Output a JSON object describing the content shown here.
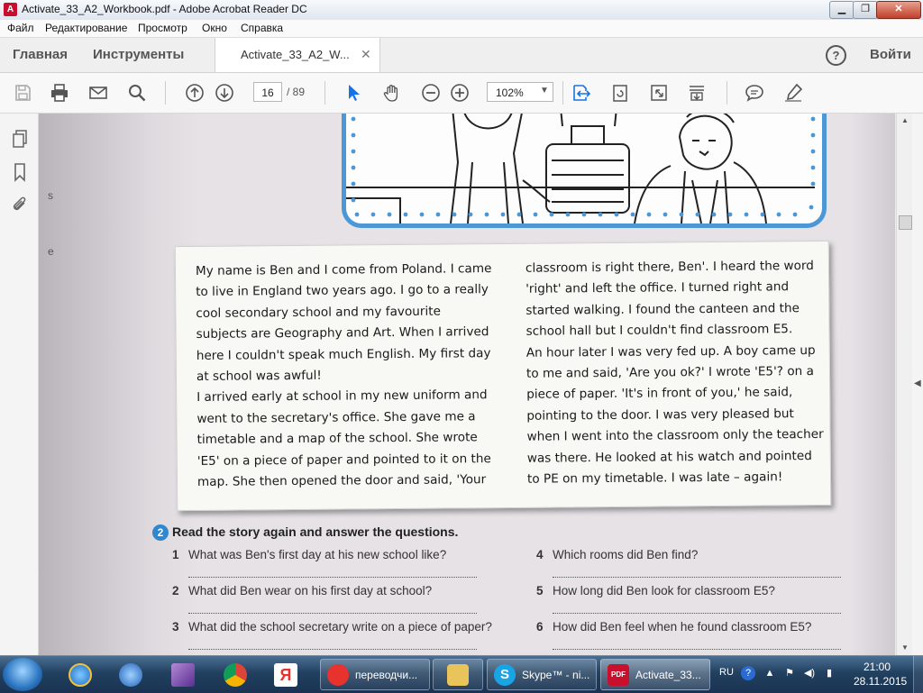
{
  "window": {
    "title": "Activate_33_A2_Workbook.pdf - Adobe Acrobat Reader DC",
    "app_icon": "acrobat-icon"
  },
  "menu": [
    "Файл",
    "Редактирование",
    "Просмотр",
    "Окно",
    "Справка"
  ],
  "tabs": {
    "home": "Главная",
    "tools": "Инструменты",
    "document": "Activate_33_A2_W...",
    "sign_in": "Войти"
  },
  "toolbar": {
    "page_current": "16",
    "page_total": "/ 89",
    "zoom": "102%"
  },
  "margin_text": [
    "s",
    "e"
  ],
  "story": {
    "left": [
      "My name is Ben and I come from Poland. I came",
      "to live in England two years ago. I go to a really",
      "cool secondary school and my favourite",
      "subjects are Geography and Art. When I arrived",
      "here I couldn't speak much English. My first day",
      "at school was awful!",
      "I arrived early at school in my new uniform and",
      "went to the secretary's office. She gave me a",
      "timetable and a map of the school. She wrote",
      "'E5' on a piece of paper and pointed to it on the",
      "map. She then opened the door and said, 'Your"
    ],
    "right": [
      "classroom is right there, Ben'. I heard the word",
      "'right' and left the office. I turned right and",
      "started walking. I found the canteen and the",
      "school hall but I couldn't find classroom E5.",
      "An hour later I was very fed up. A boy came up",
      "to me and said, 'Are you ok?' I wrote 'E5'? on a",
      "piece of paper. 'It's in front of you,' he said,",
      "pointing to the door. I was very pleased but",
      "when I went into the classroom only the teacher",
      "was there. He looked at his watch and pointed",
      "to PE on my timetable. I was late – again!"
    ]
  },
  "exercise": {
    "number": "2",
    "title": "Read the story again and answer the questions.",
    "questions": [
      {
        "n": "1",
        "text": "What was Ben's first day at his new school like?"
      },
      {
        "n": "2",
        "text": "What did Ben wear on his first day at school?"
      },
      {
        "n": "3",
        "text": "What did the school secretary write on a piece of paper?"
      },
      {
        "n": "4",
        "text": "Which rooms did Ben find?"
      },
      {
        "n": "5",
        "text": "How long did Ben look for classroom E5?"
      },
      {
        "n": "6",
        "text": "How did Ben feel when he found classroom E5?"
      }
    ]
  },
  "taskbar": {
    "tasks": [
      {
        "label": "переводчи...",
        "icon": "yandex-icon",
        "color": "#e8322e"
      },
      {
        "label": "",
        "icon": "explorer-folder-icon",
        "color": "#e9c45a"
      },
      {
        "label": "Skype™ - ni...",
        "icon": "skype-icon",
        "color": "#19a4e6"
      },
      {
        "label": "Activate_33...",
        "icon": "acrobat-pdf-icon",
        "color": "#c8102e"
      }
    ],
    "language": "RU",
    "time": "21:00",
    "date": "28.11.2015"
  },
  "colors": {
    "accent": "#4c97d6",
    "acrobat": "#c8102e",
    "selection_tool": "#1473e6"
  }
}
